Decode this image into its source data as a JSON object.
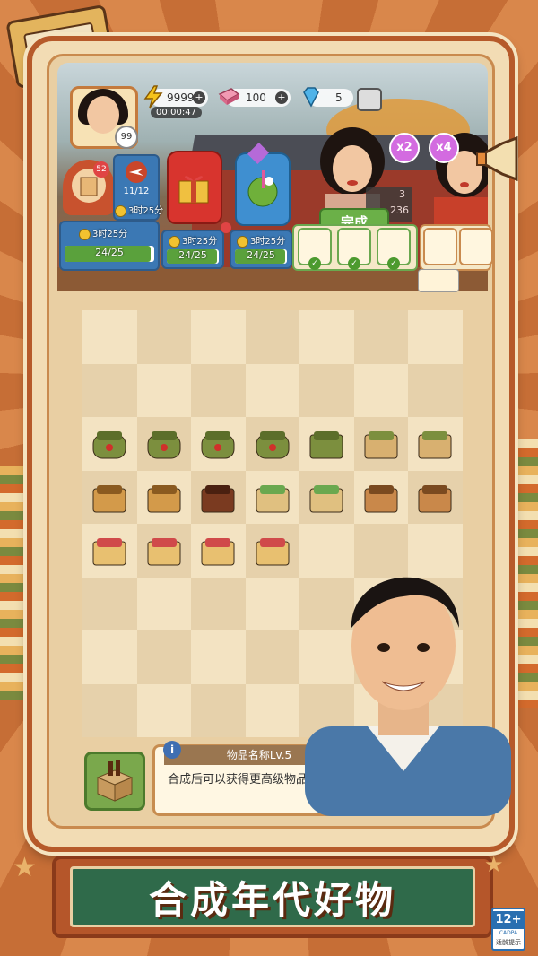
{
  "hud": {
    "energy": "99999",
    "energy_timer": "00:00:47",
    "bricks": "100",
    "gems": "5",
    "player_level": "99"
  },
  "orders": [
    {
      "badge": "52",
      "count": "11/12",
      "time": "3时25分",
      "progress": "24/25",
      "progress_fraction": 0.96
    },
    {
      "time": "3时25分",
      "progress": "24/25",
      "progress_fraction": 0.96
    },
    {
      "time": "3时25分",
      "progress": "24/25",
      "progress_fraction": 0.96
    }
  ],
  "customer": {
    "complete_label": "完成",
    "partial_numbers": [
      "3",
      "236"
    ],
    "multipliers": [
      "x2",
      "x4"
    ]
  },
  "info_panel": {
    "title": "物品名称Lv.5",
    "description": "合成后可以获得更高级物品。"
  },
  "banner": {
    "text": "合成年代好物"
  },
  "age_rating": {
    "age": "12+",
    "org": "CADPA",
    "tip": "适龄提示"
  },
  "board_items": [
    {
      "row": 2,
      "col": 0,
      "name": "green-bag-1"
    },
    {
      "row": 2,
      "col": 1,
      "name": "green-bag-2"
    },
    {
      "row": 2,
      "col": 2,
      "name": "green-bag-3"
    },
    {
      "row": 2,
      "col": 3,
      "name": "green-bag-4"
    },
    {
      "row": 2,
      "col": 4,
      "name": "green-backpack"
    },
    {
      "row": 2,
      "col": 5,
      "name": "school-desk-1"
    },
    {
      "row": 2,
      "col": 6,
      "name": "school-desk-2"
    },
    {
      "row": 3,
      "col": 0,
      "name": "wood-planks"
    },
    {
      "row": 3,
      "col": 1,
      "name": "wood-frame"
    },
    {
      "row": 3,
      "col": 2,
      "name": "wood-cabinet"
    },
    {
      "row": 3,
      "col": 3,
      "name": "display-case-1"
    },
    {
      "row": 3,
      "col": 4,
      "name": "display-case-2"
    },
    {
      "row": 3,
      "col": 5,
      "name": "shelf-1"
    },
    {
      "row": 3,
      "col": 6,
      "name": "shelf-2"
    },
    {
      "row": 4,
      "col": 0,
      "name": "shop-counter-1"
    },
    {
      "row": 4,
      "col": 1,
      "name": "shop-counter-2"
    },
    {
      "row": 4,
      "col": 2,
      "name": "shop-counter-3"
    },
    {
      "row": 4,
      "col": 3,
      "name": "toy-stall"
    }
  ]
}
